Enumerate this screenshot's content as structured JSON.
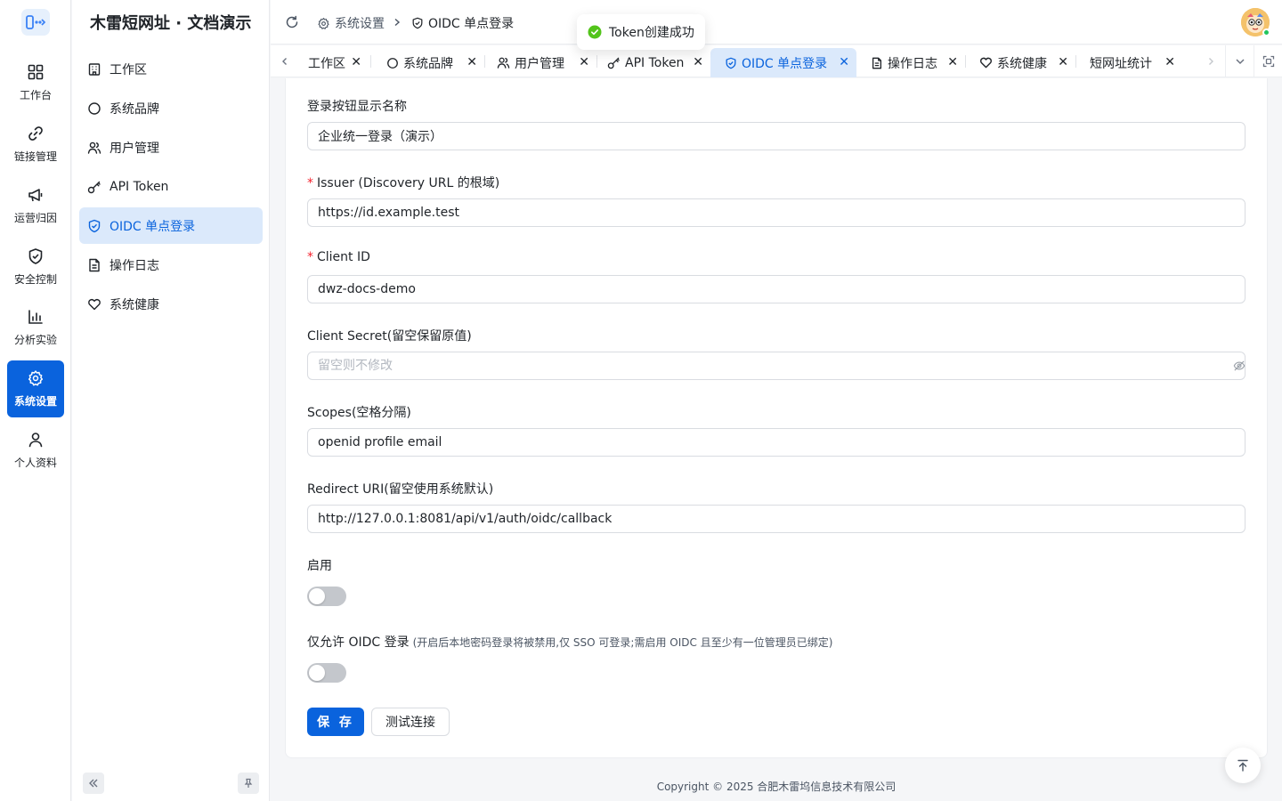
{
  "app": {
    "title": "木雷短网址 · 文档演示"
  },
  "rail": [
    {
      "label": "工作台",
      "icon": "dashboard-grid-icon"
    },
    {
      "label": "链接管理",
      "icon": "link-icon"
    },
    {
      "label": "运营归因",
      "icon": "megaphone-icon"
    },
    {
      "label": "安全控制",
      "icon": "shield-check-icon"
    },
    {
      "label": "分析实验",
      "icon": "bar-chart-icon"
    },
    {
      "label": "系统设置",
      "icon": "gear-icon",
      "active": true
    },
    {
      "label": "个人资料",
      "icon": "user-icon"
    }
  ],
  "menu": [
    {
      "label": "工作区",
      "icon": "building-icon"
    },
    {
      "label": "系统品牌",
      "icon": "circle-icon"
    },
    {
      "label": "用户管理",
      "icon": "users-icon"
    },
    {
      "label": "API Token",
      "icon": "key-icon"
    },
    {
      "label": "OIDC 单点登录",
      "icon": "shield-check-icon",
      "active": true
    },
    {
      "label": "操作日志",
      "icon": "document-icon"
    },
    {
      "label": "系统健康",
      "icon": "heart-icon"
    }
  ],
  "breadcrumb": {
    "parent": "系统设置",
    "current": "OIDC 单点登录"
  },
  "toast": {
    "text": "Token创建成功"
  },
  "tabs": [
    {
      "label": "工作区"
    },
    {
      "label": "系统品牌"
    },
    {
      "label": "用户管理"
    },
    {
      "label": "API Token"
    },
    {
      "label": "OIDC 单点登录",
      "active": true
    },
    {
      "label": "操作日志"
    },
    {
      "label": "系统健康"
    },
    {
      "label": "短网址统计"
    }
  ],
  "form": {
    "button_name": {
      "label": "登录按钮显示名称",
      "value": "企业统一登录（演示）"
    },
    "issuer": {
      "label": "Issuer (Discovery URL 的根域)",
      "value": "https://id.example.test",
      "required": true
    },
    "client_id": {
      "label": "Client ID",
      "value": "dwz-docs-demo",
      "required": true
    },
    "client_secret": {
      "label": "Client Secret(留空保留原值)",
      "placeholder": "留空则不修改",
      "value": ""
    },
    "scopes": {
      "label": "Scopes(空格分隔)",
      "value": "openid profile email"
    },
    "redirect_uri": {
      "label": "Redirect URI(留空使用系统默认)",
      "value": "http://127.0.0.1:8081/api/v1/auth/oidc/callback"
    },
    "enabled": {
      "label": "启用",
      "checked": false
    },
    "oidc_only": {
      "label": "仅允许 OIDC 登录",
      "hint": "(开启后本地密码登录将被禁用,仅 SSO 可登录;需启用 OIDC 且至少有一位管理员已绑定)",
      "checked": false
    },
    "save_label": "保 存",
    "test_label": "测试连接"
  },
  "footer": {
    "text": "Copyright © 2025 合肥木雷坞信息技术有限公司"
  },
  "colors": {
    "primary": "#0a63dd",
    "active_bg": "#dbe9fb",
    "success": "#22c55e",
    "required": "#f5222d"
  }
}
